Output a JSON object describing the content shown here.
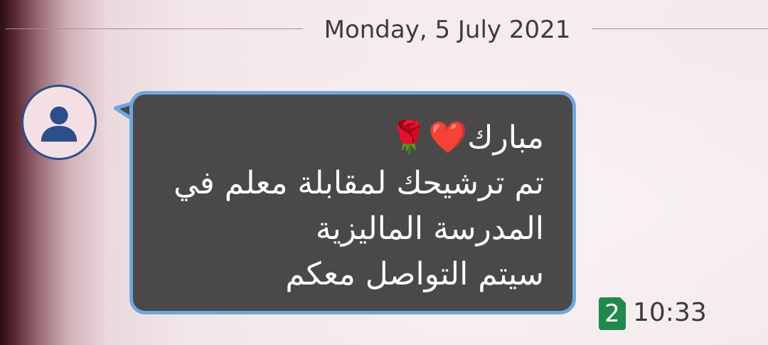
{
  "date_separator": "Monday, 5 July 2021",
  "avatar": {
    "icon": "person-icon",
    "color": "#2c4f8c"
  },
  "message": {
    "lines": [
      "مبارك❤️🌹",
      "تم ترشيحك لمقابلة معلم في",
      "المدرسة الماليزية",
      "سيتم التواصل معكم"
    ],
    "bubble_color": "#4b4849",
    "border_color": "#6ea7e0"
  },
  "meta": {
    "count": "2",
    "count_color": "#1f8a4c",
    "time": "10:33"
  }
}
